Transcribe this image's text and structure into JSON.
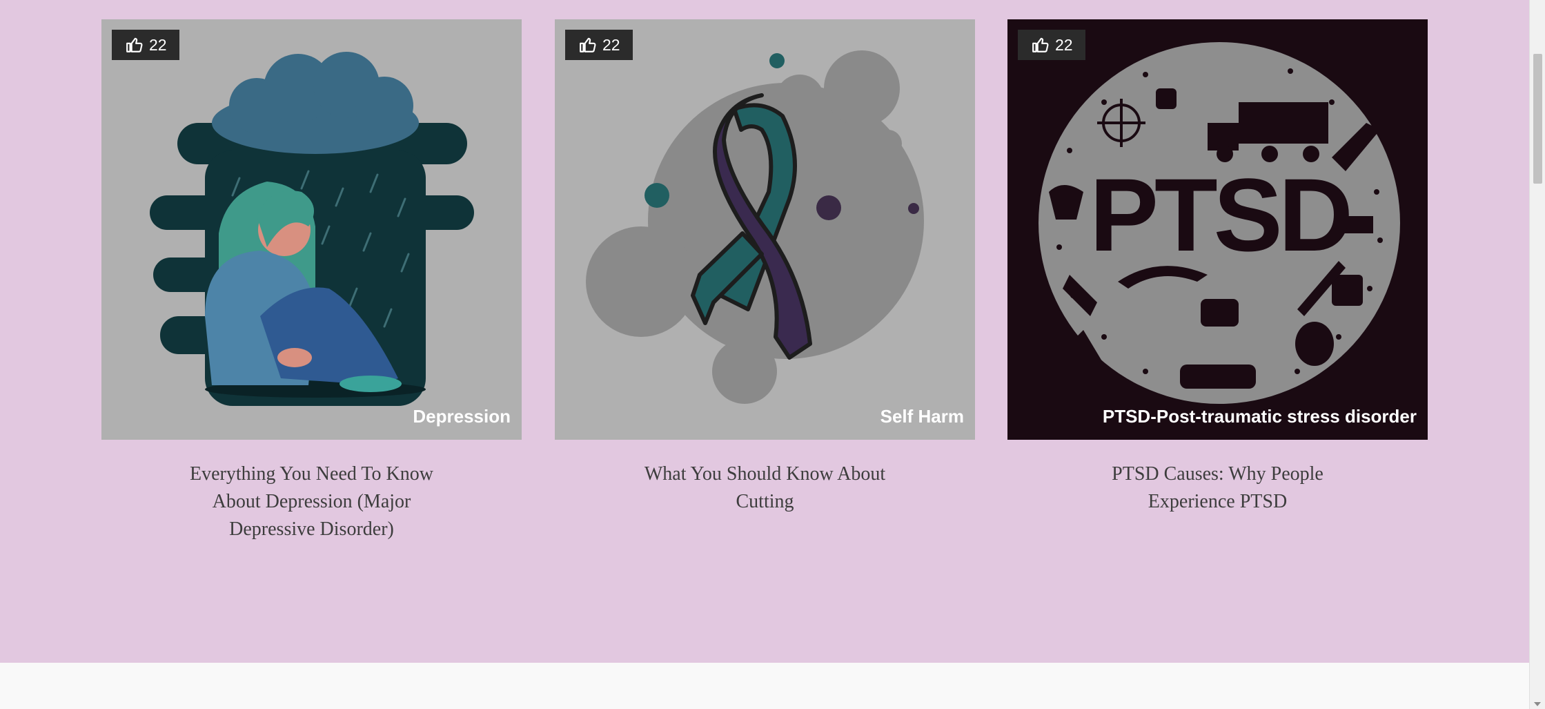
{
  "cards": [
    {
      "likes": "22",
      "category": "Depression",
      "title": "Everything You Need To Know About Depression (Major Depressive Disorder)",
      "image_icon": "sad-girl-rain-cloud-illustration",
      "bg_color": "#b0b0b0"
    },
    {
      "likes": "22",
      "category": "Self Harm",
      "title": "What You Should Know About Cutting",
      "image_icon": "awareness-ribbon-illustration",
      "bg_color": "#b0b0b0"
    },
    {
      "likes": "22",
      "category": "PTSD-Post-traumatic stress disorder",
      "title": "PTSD Causes: Why People Experience PTSD",
      "image_icon": "ptsd-military-circle-illustration",
      "bg_color": "#1a0a12"
    }
  ],
  "like_icon": "thumbs-up-icon",
  "colors": {
    "page_bg": "#e2c8e0",
    "badge_bg": "#2b2b2b",
    "title_text": "#3d3d3d"
  }
}
